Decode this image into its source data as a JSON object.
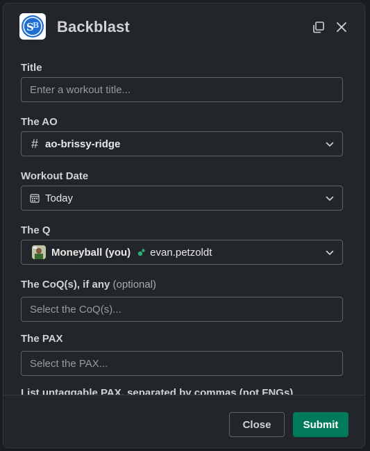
{
  "modal": {
    "title": "Backblast",
    "logo_text": "SB"
  },
  "form": {
    "title_label": "Title",
    "title_placeholder": "Enter a workout title...",
    "ao_label": "The AO",
    "ao_value": "ao-brissy-ridge",
    "date_label": "Workout Date",
    "date_value": "Today",
    "q_label": "The Q",
    "q_user": "Moneyball (you)",
    "q_user2": "evan.petzoldt",
    "coq_label": "The CoQ(s), if any",
    "coq_optional": "(optional)",
    "coq_placeholder": "Select the CoQ(s)...",
    "pax_label": "The PAX",
    "pax_placeholder": "Select the PAX...",
    "untaggable_label": "List untaggable PAX, separated by commas (not FNGs)"
  },
  "footer": {
    "close_label": "Close",
    "submit_label": "Submit"
  },
  "colors": {
    "background": "#222529",
    "submit": "#007a5a",
    "text": "#d1d2d3"
  },
  "icons": [
    "expand-icon",
    "close-icon",
    "hash-icon",
    "calendar-icon",
    "chevron-down-icon",
    "status-dot-icon"
  ]
}
